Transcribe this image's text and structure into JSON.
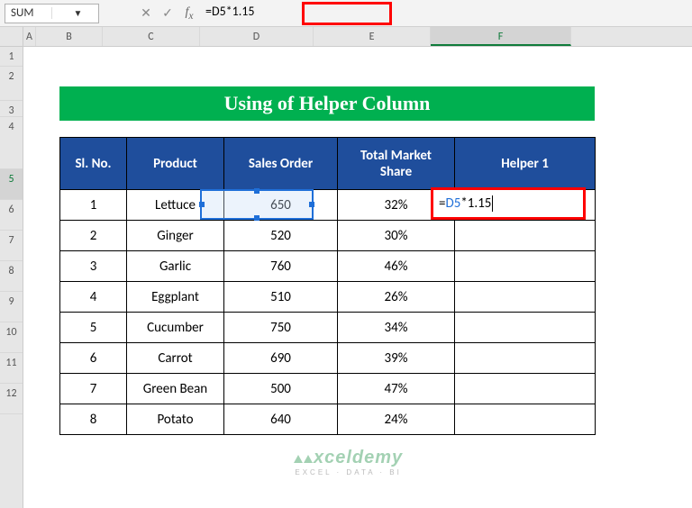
{
  "namebox": "SUM",
  "formula_bar": {
    "value": "=D5*1.15"
  },
  "title": "Using of Helper Column",
  "columns": [
    "A",
    "B",
    "C",
    "D",
    "E",
    "F"
  ],
  "rows": [
    "1",
    "2",
    "3",
    "4",
    "5",
    "6",
    "7",
    "8",
    "9",
    "10",
    "11",
    "12"
  ],
  "headers": {
    "b": "Sl. No.",
    "c": "Product",
    "d": "Sales Order",
    "e": "Total Market Share",
    "f": "Helper 1"
  },
  "data": [
    {
      "sl": "1",
      "prod": "Lettuce",
      "order": "650",
      "share": "32%"
    },
    {
      "sl": "2",
      "prod": "Ginger",
      "order": "520",
      "share": "30%"
    },
    {
      "sl": "3",
      "prod": "Garlic",
      "order": "760",
      "share": "46%"
    },
    {
      "sl": "4",
      "prod": "Eggplant",
      "order": "510",
      "share": "26%"
    },
    {
      "sl": "5",
      "prod": "Cucumber",
      "order": "750",
      "share": "34%"
    },
    {
      "sl": "6",
      "prod": "Carrot",
      "order": "690",
      "share": "39%"
    },
    {
      "sl": "7",
      "prod": "Green Bean",
      "order": "500",
      "share": "47%"
    },
    {
      "sl": "8",
      "prod": "Potato",
      "order": "640",
      "share": "24%"
    }
  ],
  "editing": {
    "prefix": "=",
    "ref": "D5",
    "suffix": "*1.15"
  },
  "watermark": {
    "brand": "xceldemy",
    "tag": "EXCEL · DATA · BI"
  },
  "active": {
    "row": "5",
    "col": "F"
  }
}
